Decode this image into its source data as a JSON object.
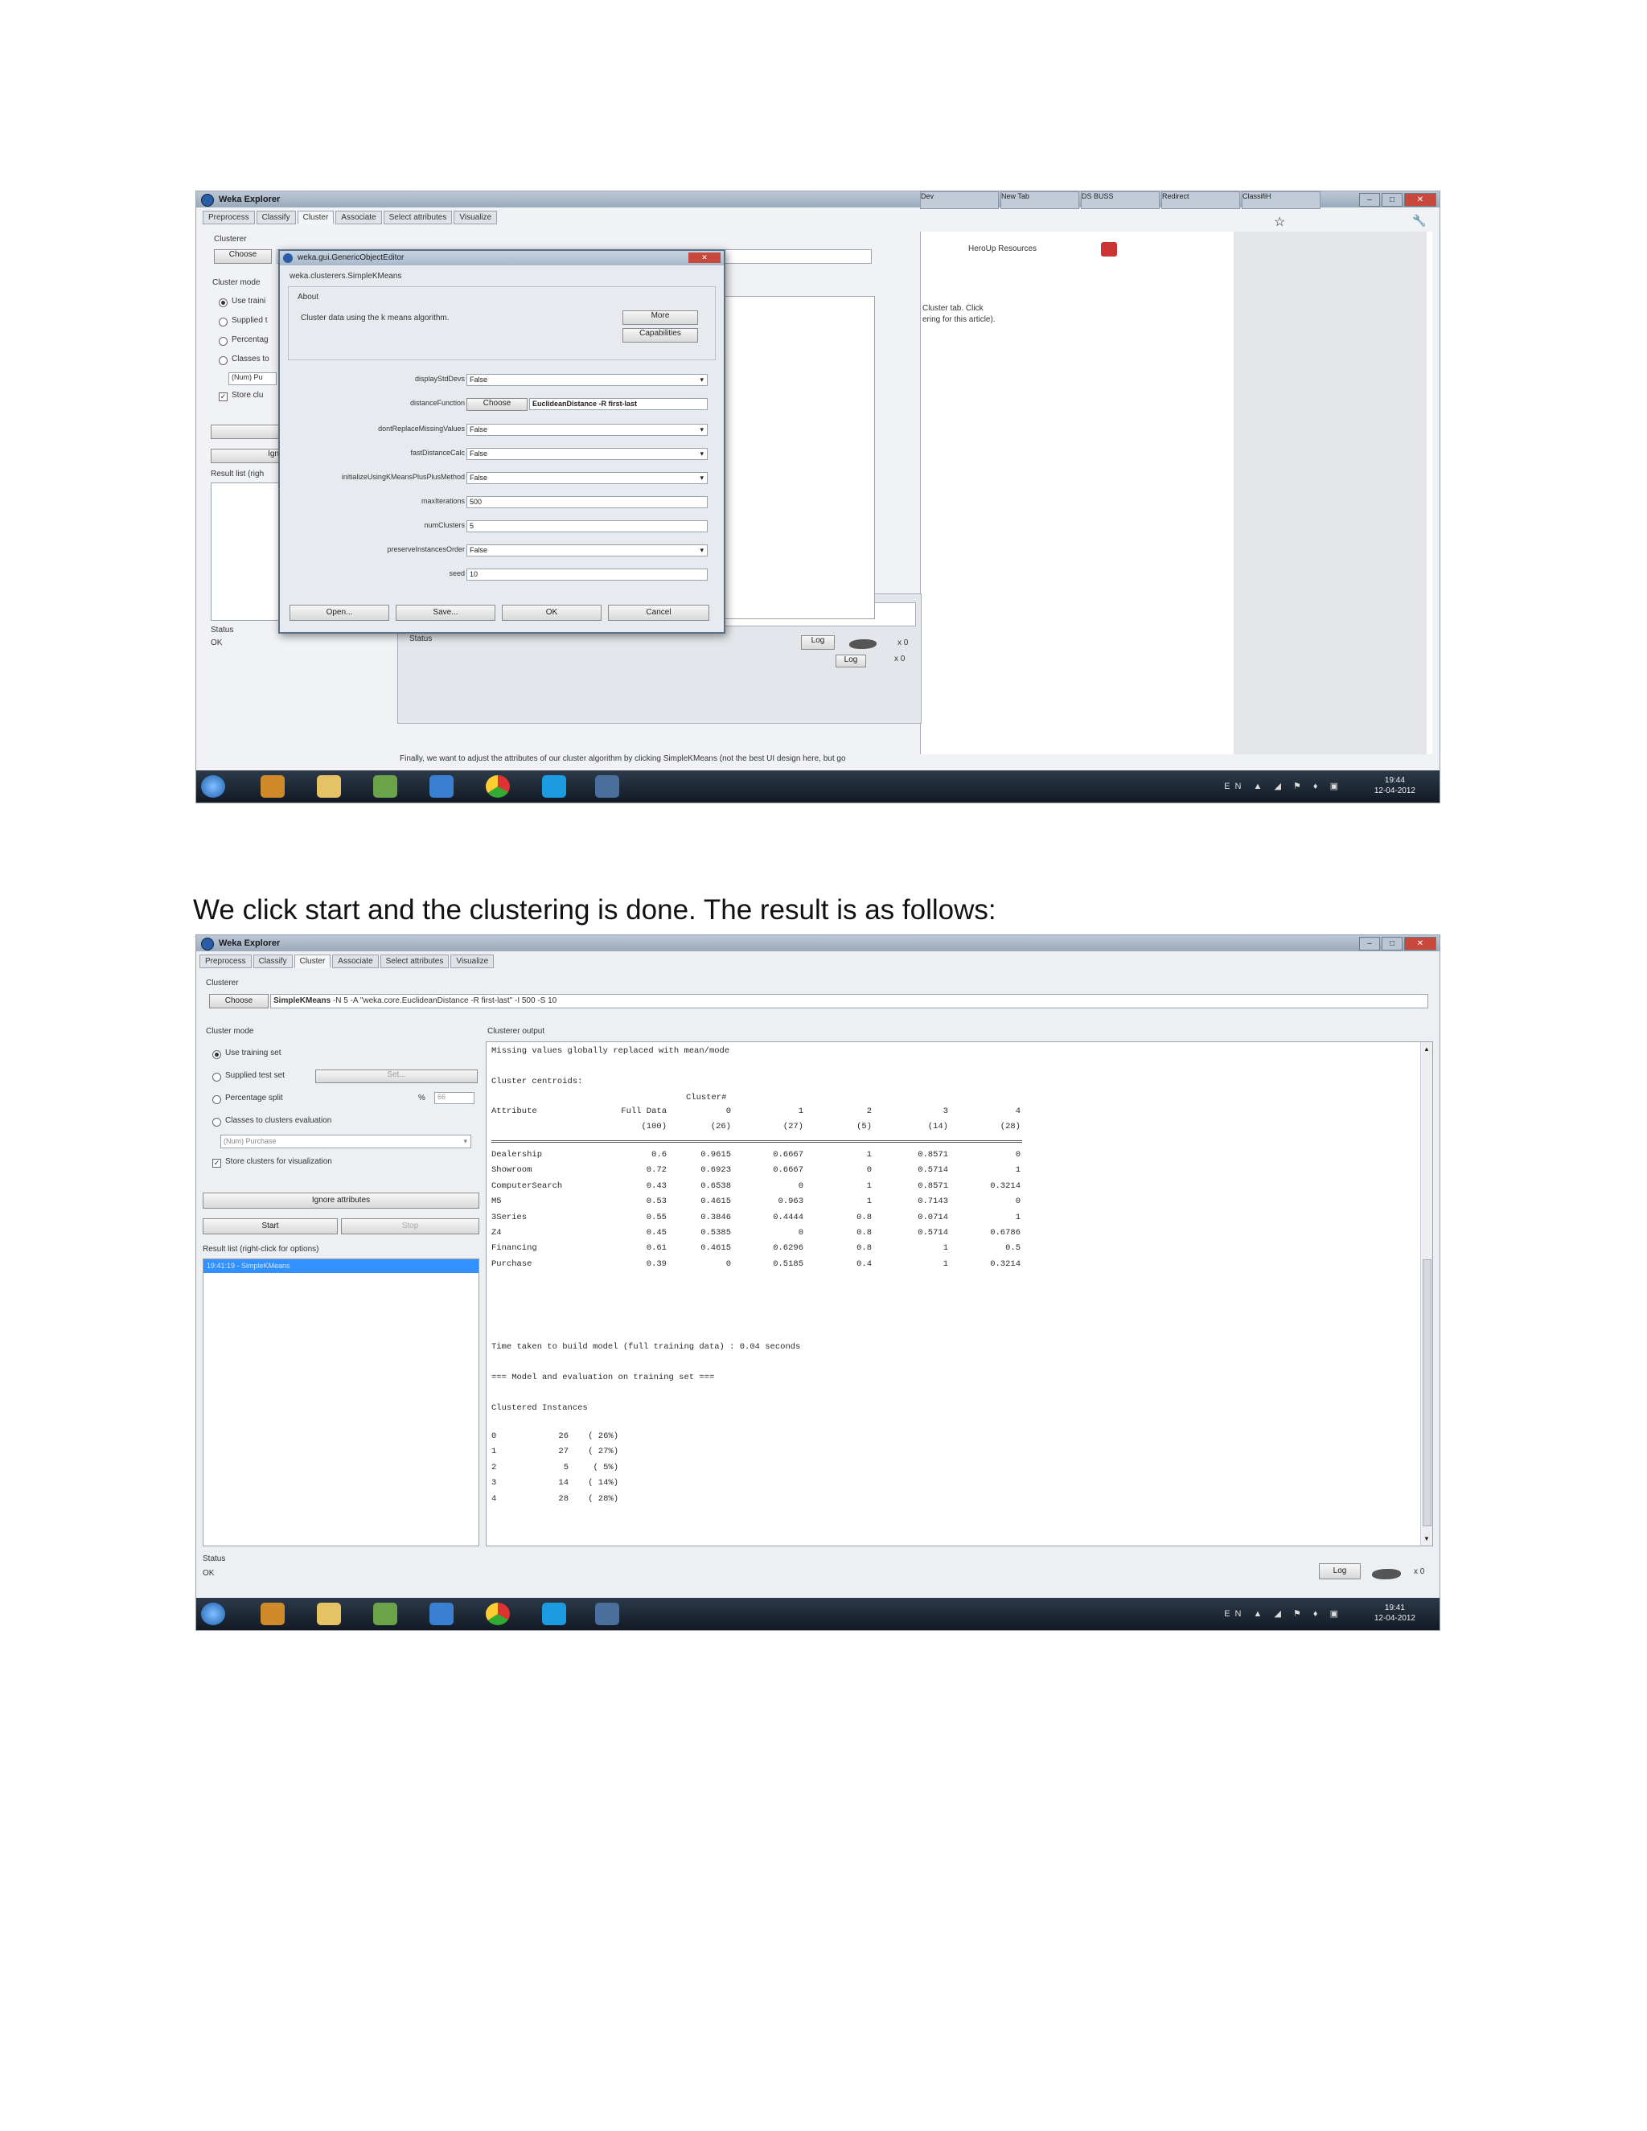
{
  "caption": "We click start and the clustering is done. The result is as follows:",
  "screenshot1": {
    "window_title": "Weka Explorer",
    "tabs": [
      "Preprocess",
      "Classify",
      "Cluster",
      "Associate",
      "Select attributes",
      "Visualize"
    ],
    "browser_tabs": [
      "Dev",
      "New Tab",
      "DS BUSS",
      "Redirect",
      "ClassifiH"
    ],
    "browser_link": "HeroUp Resources",
    "browser_text_1": "Cluster tab. Click",
    "browser_text_2": "ering for this article).",
    "browser_bottom_text": "Finally, we want to adjust the attributes of our cluster algorithm by clicking SimpleKMeans (not the best UI design here, but go",
    "left": {
      "clusterer_label": "Clusterer",
      "choose_button": "Choose",
      "cluster_mode_label": "Cluster mode",
      "mode_options": [
        "Use traini",
        "Supplied t",
        "Percentag",
        "Classes to"
      ],
      "nom_field": "(Num) Pu",
      "store_label": "Store clu",
      "ignore_button": "Ign",
      "result_list_label": "Result list (righ",
      "status_label": "Status",
      "status_value": "OK",
      "log_button": "Log",
      "x0": "x 0"
    },
    "dialog": {
      "title": "weka.gui.GenericObjectEditor",
      "class_name": "weka.clusterers.SimpleKMeans",
      "about_label": "About",
      "about_text": "Cluster data using the k means algorithm.",
      "more_button": "More",
      "capabilities_button": "Capabilities",
      "props": [
        {
          "name": "displayStdDevs",
          "value": "False",
          "kind": "select"
        },
        {
          "name": "distanceFunction",
          "value": "EuclideanDistance -R first-last",
          "kind": "choose"
        },
        {
          "name": "dontReplaceMissingValues",
          "value": "False",
          "kind": "select"
        },
        {
          "name": "fastDistanceCalc",
          "value": "False",
          "kind": "select"
        },
        {
          "name": "initializeUsingKMeansPlusPlusMethod",
          "value": "False",
          "kind": "select"
        },
        {
          "name": "maxIterations",
          "value": "500",
          "kind": "text"
        },
        {
          "name": "numClusters",
          "value": "5",
          "kind": "text"
        },
        {
          "name": "preserveInstancesOrder",
          "value": "False",
          "kind": "select"
        },
        {
          "name": "seed",
          "value": "10",
          "kind": "text"
        }
      ],
      "choose_label": "Choose",
      "buttons": [
        "Open...",
        "Save...",
        "OK",
        "Cancel"
      ]
    },
    "taskbar": {
      "lang": "EN",
      "time": "19:44",
      "date": "12-04-2012"
    }
  },
  "screenshot2": {
    "window_title": "Weka Explorer",
    "tabs": [
      "Preprocess",
      "Classify",
      "Cluster",
      "Associate",
      "Select attributes",
      "Visualize"
    ],
    "clusterer_label": "Clusterer",
    "choose_button": "Choose",
    "algo_name": "SimpleKMeans",
    "algo_params": " -N 5 -A \"weka.core.EuclideanDistance -R first-last\" -I 500 -S 10",
    "cluster_mode_label": "Cluster mode",
    "modes": [
      "Use training set",
      "Supplied test set",
      "Percentage split",
      "Classes to clusters evaluation"
    ],
    "set_button": "Set...",
    "pct_symbol": "%",
    "pct_value": "66",
    "nom_field": "(Num) Purchase",
    "store_label": "Store clusters for visualization",
    "ignore_button": "Ignore attributes",
    "start_button": "Start",
    "stop_button": "Stop",
    "result_list_label": "Result list (right-click for options)",
    "result_item": "19:41:19 - SimpleKMeans",
    "output_label": "Clusterer output",
    "output": {
      "missing_line": "Missing values globally replaced with mean/mode",
      "centroids_label": "Cluster centroids:",
      "cluster_hash": "Cluster#",
      "header": [
        "Attribute",
        "Full Data",
        "0",
        "1",
        "2",
        "3",
        "4"
      ],
      "counts": [
        "(100)",
        "(26)",
        "(27)",
        "(5)",
        "(14)",
        "(28)"
      ],
      "rows": [
        {
          "attr": "Dealership",
          "vals": [
            "0.6",
            "0.9615",
            "0.6667",
            "1",
            "0.8571",
            "0"
          ]
        },
        {
          "attr": "Showroom",
          "vals": [
            "0.72",
            "0.6923",
            "0.6667",
            "0",
            "0.5714",
            "1"
          ]
        },
        {
          "attr": "ComputerSearch",
          "vals": [
            "0.43",
            "0.6538",
            "0",
            "1",
            "0.8571",
            "0.3214"
          ]
        },
        {
          "attr": "M5",
          "vals": [
            "0.53",
            "0.4615",
            "0.963",
            "1",
            "0.7143",
            "0"
          ]
        },
        {
          "attr": "3Series",
          "vals": [
            "0.55",
            "0.3846",
            "0.4444",
            "0.8",
            "0.0714",
            "1"
          ]
        },
        {
          "attr": "Z4",
          "vals": [
            "0.45",
            "0.5385",
            "0",
            "0.8",
            "0.5714",
            "0.6786"
          ]
        },
        {
          "attr": "Financing",
          "vals": [
            "0.61",
            "0.4615",
            "0.6296",
            "0.8",
            "1",
            "0.5"
          ]
        },
        {
          "attr": "Purchase",
          "vals": [
            "0.39",
            "0",
            "0.5185",
            "0.4",
            "1",
            "0.3214"
          ]
        }
      ],
      "time_line": "Time taken to build model (full training data) : 0.04 seconds",
      "eval_line": "=== Model and evaluation on training set ===",
      "clustered_label": "Clustered Instances",
      "instances": [
        {
          "id": "0",
          "count": "26",
          "pct": "( 26%)"
        },
        {
          "id": "1",
          "count": "27",
          "pct": "( 27%)"
        },
        {
          "id": "2",
          "count": "5",
          "pct": "(  5%)"
        },
        {
          "id": "3",
          "count": "14",
          "pct": "( 14%)"
        },
        {
          "id": "4",
          "count": "28",
          "pct": "( 28%)"
        }
      ]
    },
    "status_label": "Status",
    "status_value": "OK",
    "log_button": "Log",
    "x0": "x 0",
    "taskbar": {
      "lang": "EN",
      "time": "19:41",
      "date": "12-04-2012"
    }
  }
}
